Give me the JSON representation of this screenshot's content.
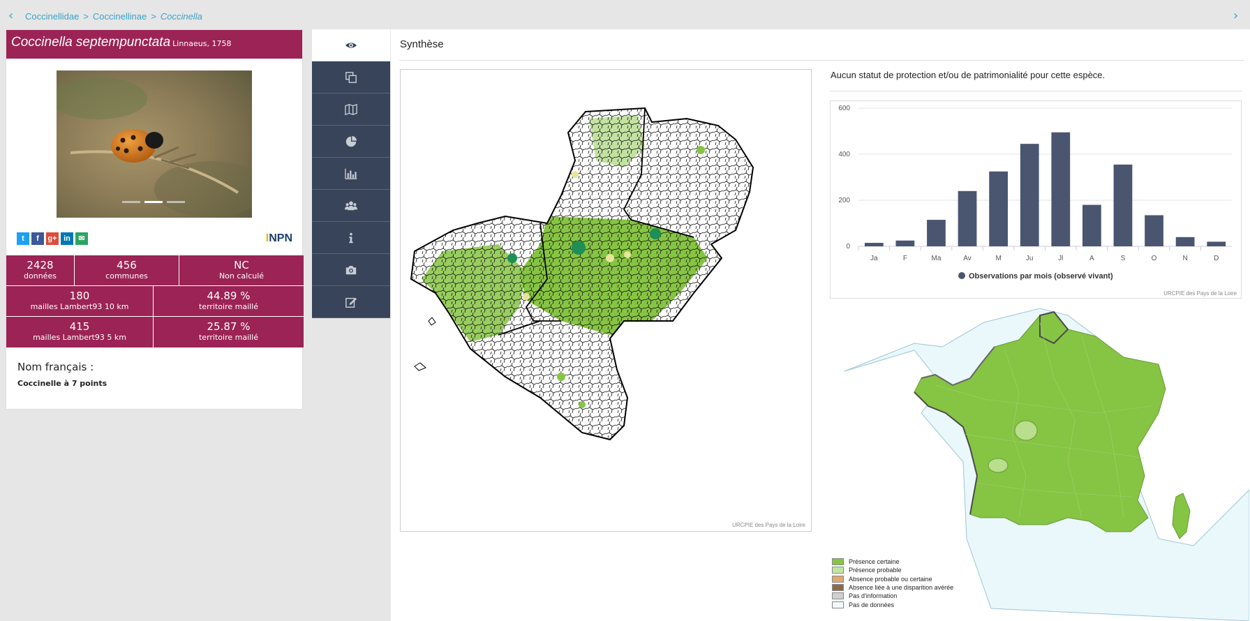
{
  "breadcrumb": {
    "items": [
      "Coccinellidae",
      "Coccinellinae",
      "Coccinella"
    ],
    "separator": ">"
  },
  "species": {
    "name": "Coccinella septempunctata",
    "author": "Linnaeus, 1758"
  },
  "social": {
    "icons": [
      "twitter-icon",
      "facebook-icon",
      "google-plus-icon",
      "linkedin-icon",
      "email-icon"
    ],
    "glyphs": [
      "t",
      "f",
      "g+",
      "in",
      "✉"
    ],
    "colors": [
      "#1da1f2",
      "#3b5998",
      "#dd4b39",
      "#0077b5",
      "#2ba462"
    ],
    "logo": "INPN"
  },
  "stats": {
    "row1": [
      {
        "value": "2428",
        "label": "données"
      },
      {
        "value": "456",
        "label": "communes"
      },
      {
        "value": "NC",
        "label": "Non calculé"
      }
    ],
    "row2": [
      {
        "value": "180",
        "label": "mailles Lambert93 10 km"
      },
      {
        "value": "44.89 %",
        "label": "territoire maillé"
      }
    ],
    "row3": [
      {
        "value": "415",
        "label": "mailles Lambert93 5 km"
      },
      {
        "value": "25.87 %",
        "label": "territoire maillé"
      }
    ]
  },
  "french_name": {
    "label": "Nom français :",
    "value": "Coccinelle à 7 points"
  },
  "tabs": [
    "eye-icon",
    "copy-icon",
    "map-icon",
    "pie-chart-icon",
    "bar-chart-icon",
    "users-icon",
    "info-icon",
    "camera-icon",
    "edit-icon"
  ],
  "main": {
    "section_title": "Synthèse",
    "map_credit": "URCPIE des Pays de la Loire",
    "status_text": "Aucun statut de protection et/ou de patrimonialité pour cette espèce.",
    "chart_credit": "URCPIE des Pays de la Loire"
  },
  "colors": {
    "accent": "#9b2355",
    "tab_bg": "#384459",
    "bar": "#4a5570",
    "presence": "#86c443"
  },
  "chart_data": {
    "type": "bar",
    "categories": [
      "Ja",
      "F",
      "Ma",
      "Av",
      "M",
      "Ju",
      "Jl",
      "A",
      "S",
      "O",
      "N",
      "D"
    ],
    "series": [
      {
        "name": "Observations par mois (observé vivant)",
        "values": [
          15,
          25,
          115,
          240,
          325,
          445,
          495,
          180,
          355,
          135,
          40,
          20
        ]
      }
    ],
    "ylim": [
      0,
      600
    ],
    "yticks": [
      0,
      200,
      400,
      600
    ],
    "legend_position": "bottom"
  },
  "legend": [
    {
      "label": "Présence certaine",
      "color": "#86c443"
    },
    {
      "label": "Présence probable",
      "color": "#c3e6a3"
    },
    {
      "label": "Absence probable ou certaine",
      "color": "#e0a872"
    },
    {
      "label": "Absence liée à une disparition avérée",
      "color": "#8b6a4c"
    },
    {
      "label": "Pas d'information",
      "color": "#d0d0d0"
    },
    {
      "label": "Pas de données",
      "color": "#f4fbfd"
    }
  ]
}
